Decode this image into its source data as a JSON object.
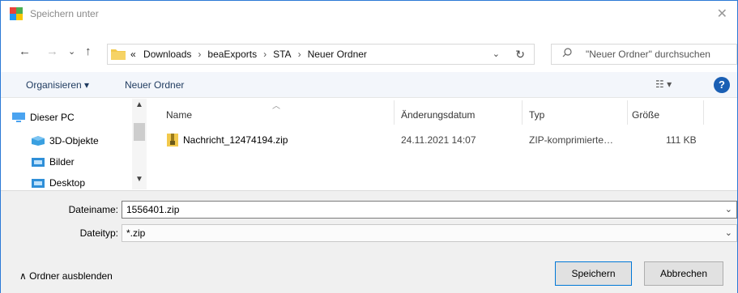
{
  "window": {
    "title": "Speichern unter",
    "close_glyph": "✕",
    "app_icon": "save-dialog-icon"
  },
  "nav": {
    "back": "←",
    "forward": "→",
    "recent": "⌄",
    "up": "↑",
    "breadcrumbs_prefix": "«",
    "breadcrumbs": [
      "Downloads",
      "beaExports",
      "STA",
      "Neuer Ordner"
    ],
    "separator": "›",
    "dropdown": "⌄",
    "refresh": "↻",
    "search_placeholder": "\"Neuer Ordner\" durchsuchen"
  },
  "toolbar": {
    "organize": "Organisieren ▾",
    "new_folder": "Neuer Ordner",
    "view": "☷ ▾",
    "help": "?"
  },
  "navpane": {
    "items": [
      {
        "label": "Dieser PC",
        "icon": "pc-icon"
      },
      {
        "label": "3D-Objekte",
        "icon": "3d-objects-icon"
      },
      {
        "label": "Bilder",
        "icon": "pictures-folder-icon"
      },
      {
        "label": "Desktop",
        "icon": "desktop-folder-icon"
      }
    ]
  },
  "filelist": {
    "columns": [
      "Name",
      "Änderungsdatum",
      "Typ",
      "Größe"
    ],
    "rows": [
      {
        "name": "Nachricht_12474194.zip",
        "date": "24.11.2021 14:07",
        "type": "ZIP-komprimierte…",
        "size": "111 KB"
      }
    ]
  },
  "form": {
    "filename_label": "Dateiname:",
    "filename_value": "1556401.zip",
    "filetype_label": "Dateityp:",
    "filetype_value": "*.zip",
    "chevron": "⌄"
  },
  "footer": {
    "toggle_label": "∧  Ordner ausblenden",
    "save": "Speichern",
    "cancel": "Abbrechen"
  },
  "colors": {
    "accent": "#0078d7",
    "help_icon": "#1a5fb4",
    "folder": "#f2c94c"
  }
}
